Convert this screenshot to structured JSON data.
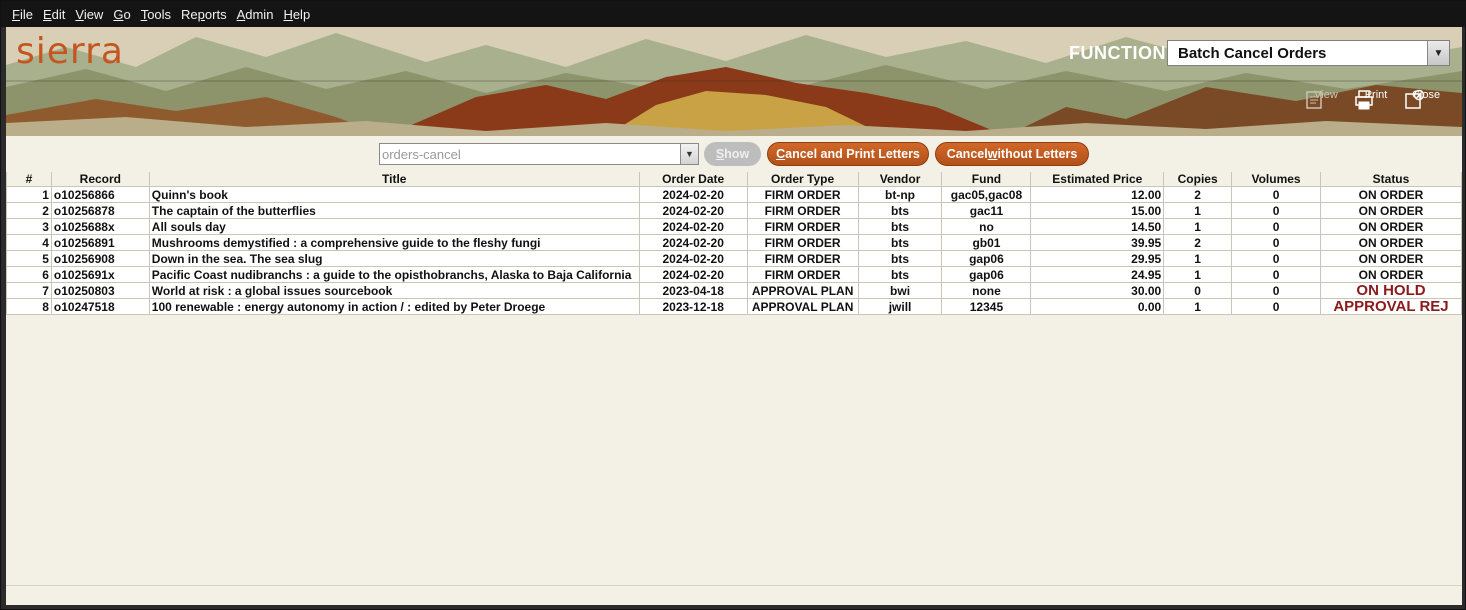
{
  "menu": [
    {
      "u": "F",
      "rest": "ile"
    },
    {
      "u": "E",
      "rest": "dit"
    },
    {
      "u": "V",
      "rest": "iew"
    },
    {
      "u": "G",
      "rest": "o"
    },
    {
      "u": "T",
      "rest": "ools"
    },
    {
      "pre": "Re",
      "u": "p",
      "rest": "orts"
    },
    {
      "u": "A",
      "rest": "dmin"
    },
    {
      "u": "H",
      "rest": "elp"
    }
  ],
  "banner": {
    "logo": "sierra",
    "function_label": "FUNCTION",
    "function_value": "Batch Cancel Orders",
    "tools": {
      "view": "View",
      "print": "Print",
      "close": "Close"
    }
  },
  "toolbar": {
    "review_file": "orders-cancel",
    "show": {
      "u": "S",
      "rest": "how"
    },
    "cancel_print": {
      "u": "C",
      "rest": "ancel and Print Letters"
    },
    "cancel_no_letters": {
      "pre": "Cancel ",
      "u": "w",
      "rest": "ithout Letters"
    }
  },
  "table": {
    "headers": [
      "#",
      "Record",
      "Title",
      "Order Date",
      "Order Type",
      "Vendor",
      "Fund",
      "Estimated Price",
      "Copies",
      "Volumes",
      "Status"
    ],
    "rows": [
      [
        "1",
        "o10256866",
        "Quinn's book",
        "2024-02-20",
        "FIRM ORDER",
        "bt-np",
        "gac05,gac08",
        "12.00",
        "2",
        "0",
        "ON ORDER"
      ],
      [
        "2",
        "o10256878",
        "The captain of the butterflies",
        "2024-02-20",
        "FIRM ORDER",
        "bts",
        "gac11",
        "15.00",
        "1",
        "0",
        "ON ORDER"
      ],
      [
        "3",
        "o1025688x",
        "All souls day",
        "2024-02-20",
        "FIRM ORDER",
        "bts",
        "no",
        "14.50",
        "1",
        "0",
        "ON ORDER"
      ],
      [
        "4",
        "o10256891",
        "Mushrooms demystified : a comprehensive guide to the fleshy fungi",
        "2024-02-20",
        "FIRM ORDER",
        "bts",
        "gb01",
        "39.95",
        "2",
        "0",
        "ON ORDER"
      ],
      [
        "5",
        "o10256908",
        "Down in the sea. The sea slug",
        "2024-02-20",
        "FIRM ORDER",
        "bts",
        "gap06",
        "29.95",
        "1",
        "0",
        "ON ORDER"
      ],
      [
        "6",
        "o1025691x",
        "Pacific Coast nudibranchs : a guide to the opisthobranchs, Alaska to Baja California",
        "2024-02-20",
        "FIRM ORDER",
        "bts",
        "gap06",
        "24.95",
        "1",
        "0",
        "ON ORDER"
      ],
      [
        "7",
        "o10250803",
        "World at risk : a global issues sourcebook",
        "2023-04-18",
        "APPROVAL PLAN",
        "bwi",
        "none",
        "30.00",
        "0",
        "0",
        "ON HOLD"
      ],
      [
        "8",
        "o10247518",
        "100 renewable : energy autonomy in action / : edited by Peter Droege",
        "2023-12-18",
        "APPROVAL PLAN",
        "jwill",
        "12345",
        "0.00",
        "1",
        "0",
        "APPROVAL REJ"
      ]
    ]
  },
  "colors": {
    "accent_orange": "#c4561f",
    "status_alert": "#8b1a1a"
  }
}
